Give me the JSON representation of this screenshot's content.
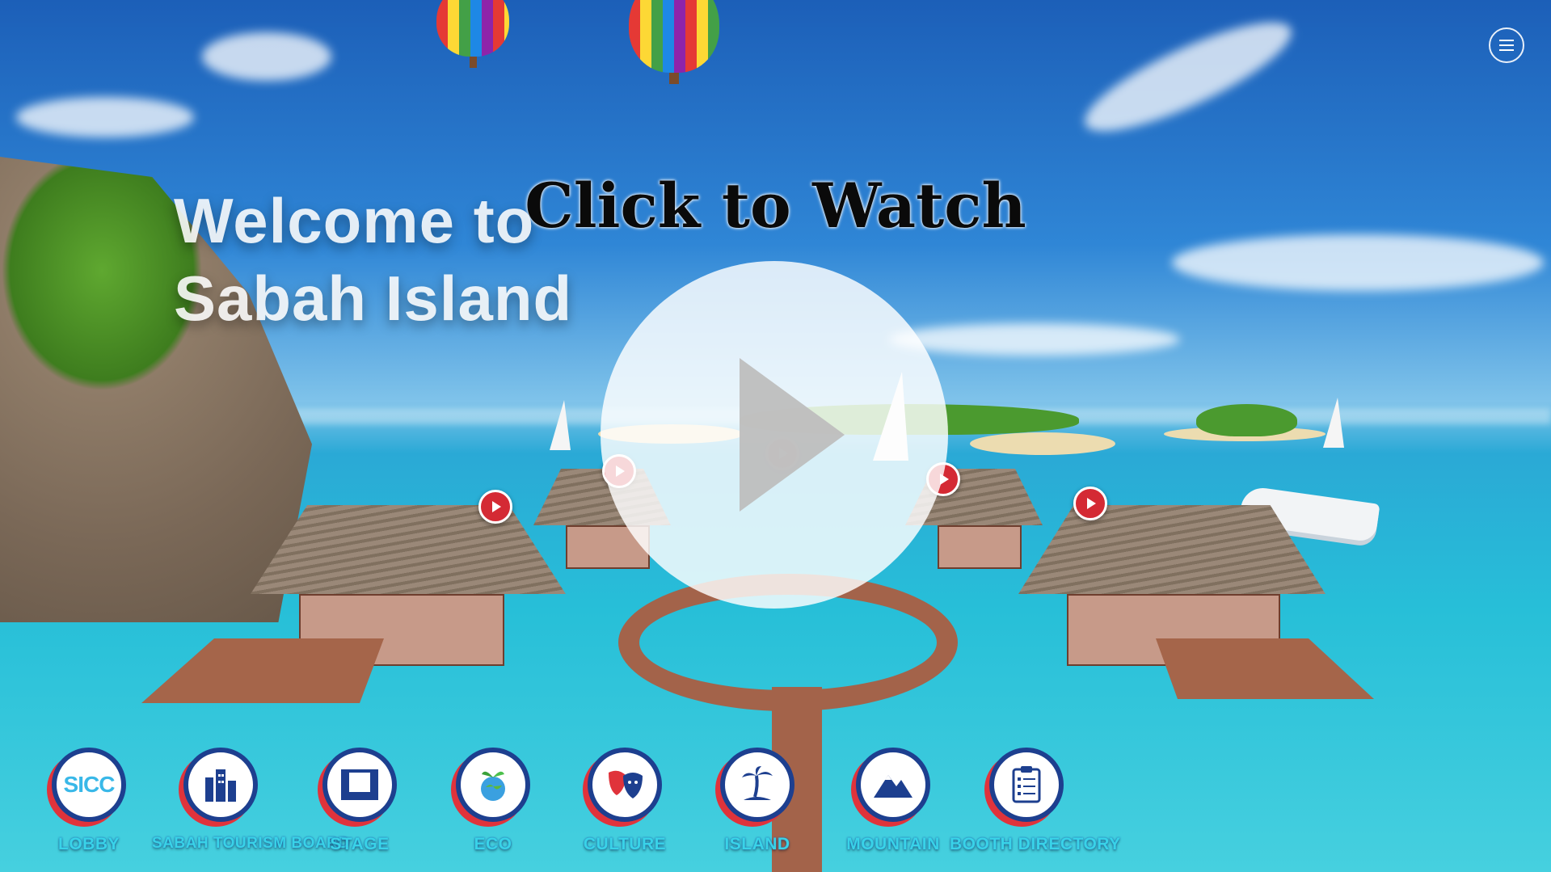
{
  "scene": {
    "welcome_line1": "Welcome to",
    "welcome_line2": "Sabah Island"
  },
  "overlay": {
    "watch_title": "Click to Watch",
    "play_icon": "play-icon",
    "menu_icon": "hamburger-menu-icon"
  },
  "nav": [
    {
      "label": "LOBBY",
      "icon": "sicc-logo-icon",
      "icon_text": "SICC"
    },
    {
      "label": "SABAH TOURISM BOARD",
      "icon": "city-buildings-icon"
    },
    {
      "label": "STAGE",
      "icon": "stage-icon"
    },
    {
      "label": "ECO",
      "icon": "globe-plant-icon"
    },
    {
      "label": "CULTURE",
      "icon": "theatre-masks-icon"
    },
    {
      "label": "ISLAND",
      "icon": "palm-island-icon"
    },
    {
      "label": "MOUNTAIN",
      "icon": "mountain-icon"
    },
    {
      "label": "BOOTH DIRECTORY",
      "icon": "clipboard-icon"
    }
  ],
  "colors": {
    "nav_ring": "#1d3f8f",
    "nav_accent": "#e0333b",
    "nav_label": "#39d3e8",
    "video_pin": "#d42a34"
  }
}
